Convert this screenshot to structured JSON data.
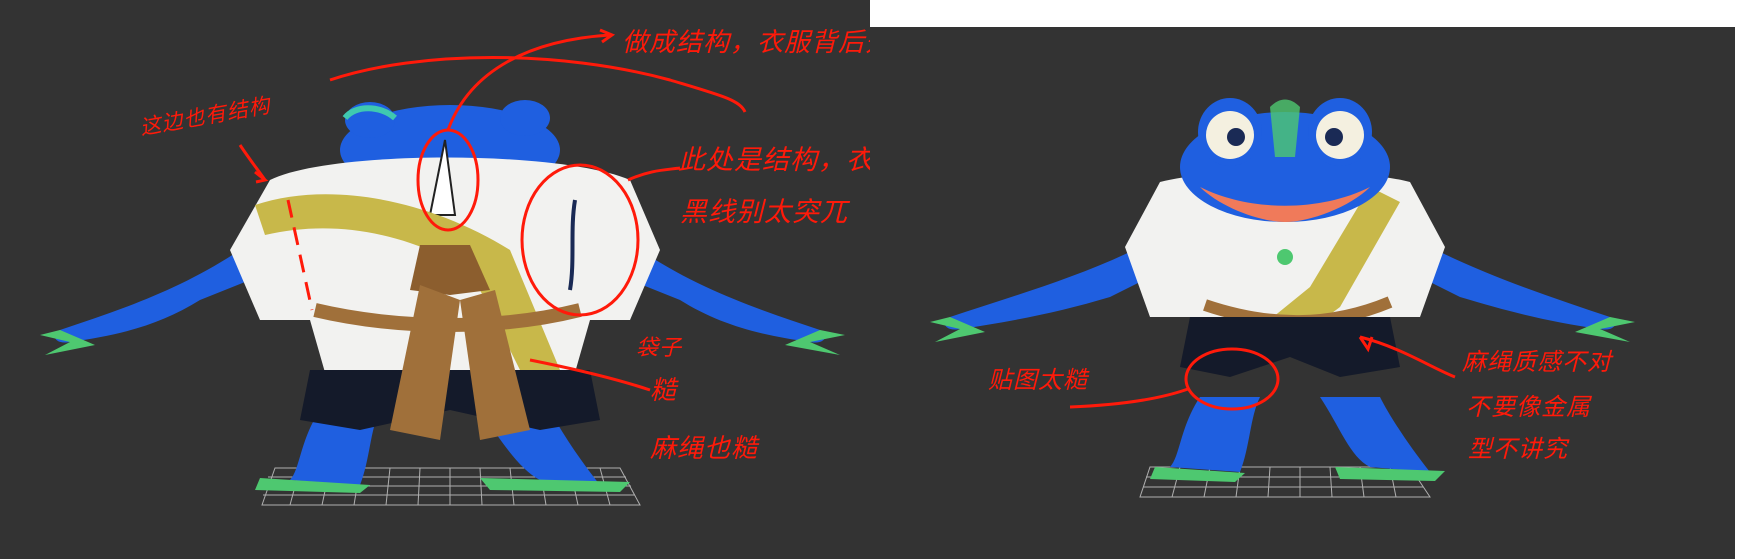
{
  "annotations": {
    "left": {
      "structure_back_opening": "做成结构，衣服背后开口子",
      "side_structure": "这边也有结构",
      "seam_structure": "此处是结构，衣料缝合处",
      "seam_black_line": "黑线别太突兀",
      "belt_line1": "袋子",
      "belt_line2": "糙",
      "rope_rough": "麻绳也糙"
    },
    "right": {
      "decal_rough": "贴图太糙",
      "rope_texture_line1": "麻绳质感不对",
      "rope_texture_line2": "不要像金属",
      "rope_texture_line3": "型不讲究"
    }
  },
  "colors": {
    "background": "#333333",
    "annotation": "#ff1a0a",
    "frog_skin": "#1f5fe0",
    "shirt": "#f2f2f0",
    "sash": "#c8b84a",
    "rope": "#a0703a",
    "shorts": "#141a2a",
    "grid": "#cfcfcf"
  }
}
